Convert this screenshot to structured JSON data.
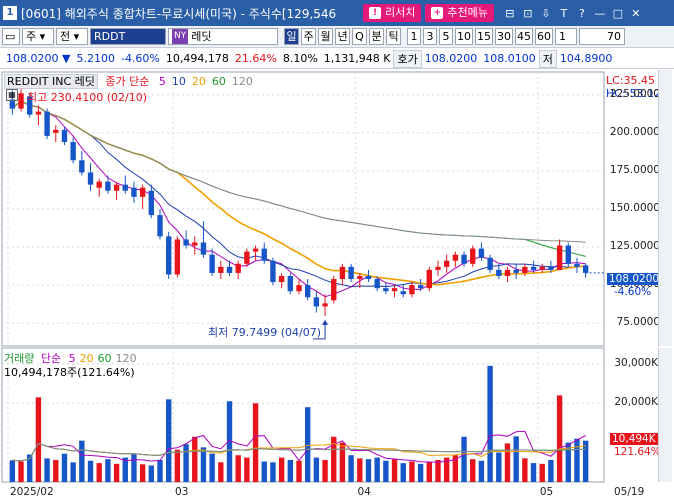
{
  "window": {
    "num": "1",
    "title": "[0601] 해외주식 종합차트-무료시세(미국) - 주식수[129,546",
    "btn_research": "리서치",
    "btn_recommend": "추천메뉴",
    "ctl_icons": [
      "⊟",
      "⊡",
      "⇩",
      "T",
      "?",
      "—",
      "□",
      "✕"
    ]
  },
  "toolbar": {
    "market": "주",
    "market2": "전",
    "symbol": "RDDT",
    "nv_badge": "NY",
    "name": "레딧",
    "periods": [
      "일",
      "주",
      "월",
      "년",
      "Q",
      "분",
      "틱"
    ],
    "active_period": "일",
    "intervals": [
      "1",
      "3",
      "5",
      "10",
      "15",
      "30",
      "45",
      "60"
    ],
    "interval_value": "1",
    "count": "70"
  },
  "info": {
    "price": "108.0200",
    "change": "5.2100",
    "change_rate": "-4.60%",
    "volume": "10,494,178",
    "vol_rate": "21.64%",
    "turnover": "8.10%",
    "amount": "1,131,948",
    "amount_unit": "K",
    "ask_label": "호가",
    "ask": "108.0200",
    "bid": "108.0100",
    "low_label": "저",
    "low": "104.8900"
  },
  "price_panel": {
    "name": "REDDIT INC",
    "name_ko": "레딧",
    "series_label": "종가 단순",
    "ma_periods": [
      "5",
      "10",
      "20",
      "60",
      "120"
    ],
    "ma_colors": [
      "#b000c0",
      "#1d3fb0",
      "#f0a000",
      "#1f9a2f",
      "#8a8a8a"
    ],
    "high_note": "최고 230.4100 (02/10)",
    "low_note": "최저 79.7499 (04/07)",
    "lc": "LC:35.45",
    "hc": "HC:-53.12",
    "cur_tag": "108.0200",
    "cur_rate": "-4.60%",
    "y_ticks": [
      "225.0000",
      "200.0000",
      "175.0000",
      "150.0000",
      "125.0000",
      "100.0000",
      "75.0000"
    ]
  },
  "volume_panel": {
    "label": "거래량",
    "series_label": "단순",
    "ma_periods": [
      "5",
      "20",
      "60",
      "120"
    ],
    "value_note": "10,494,178주(121.64%)",
    "y_ticks": [
      "30,000K",
      "20,000K"
    ],
    "cur_tag": "10,494K",
    "cur_rate": "121.64%"
  },
  "x_labels": [
    "2025/02",
    "03",
    "04",
    "05",
    "05/19"
  ],
  "colors": {
    "up": "#e8141b",
    "down": "#1656c9",
    "title_bg": "#2a5fa8",
    "accent": "#e5197a"
  },
  "chart_data": {
    "type": "candlestick",
    "ylim": [
      60,
      240
    ],
    "candles": [
      {
        "o": 222,
        "h": 228,
        "l": 212,
        "c": 216
      },
      {
        "o": 216,
        "h": 230.41,
        "l": 214,
        "c": 226
      },
      {
        "o": 224,
        "h": 226,
        "l": 210,
        "c": 212
      },
      {
        "o": 212,
        "h": 218,
        "l": 205,
        "c": 214
      },
      {
        "o": 214,
        "h": 216,
        "l": 196,
        "c": 198
      },
      {
        "o": 200,
        "h": 205,
        "l": 194,
        "c": 202
      },
      {
        "o": 202,
        "h": 204,
        "l": 192,
        "c": 194
      },
      {
        "o": 194,
        "h": 197,
        "l": 180,
        "c": 182
      },
      {
        "o": 182,
        "h": 188,
        "l": 172,
        "c": 174
      },
      {
        "o": 174,
        "h": 180,
        "l": 162,
        "c": 166
      },
      {
        "o": 164,
        "h": 170,
        "l": 158,
        "c": 168
      },
      {
        "o": 168,
        "h": 172,
        "l": 160,
        "c": 162
      },
      {
        "o": 162,
        "h": 168,
        "l": 156,
        "c": 166
      },
      {
        "o": 166,
        "h": 172,
        "l": 160,
        "c": 162
      },
      {
        "o": 164,
        "h": 168,
        "l": 154,
        "c": 158
      },
      {
        "o": 158,
        "h": 166,
        "l": 150,
        "c": 164
      },
      {
        "o": 162,
        "h": 166,
        "l": 144,
        "c": 146
      },
      {
        "o": 146,
        "h": 150,
        "l": 130,
        "c": 132
      },
      {
        "o": 132,
        "h": 135,
        "l": 104,
        "c": 107
      },
      {
        "o": 107,
        "h": 132,
        "l": 105,
        "c": 130
      },
      {
        "o": 130,
        "h": 136,
        "l": 124,
        "c": 126
      },
      {
        "o": 126,
        "h": 132,
        "l": 120,
        "c": 128
      },
      {
        "o": 128,
        "h": 142,
        "l": 118,
        "c": 120
      },
      {
        "o": 120,
        "h": 124,
        "l": 106,
        "c": 108
      },
      {
        "o": 108,
        "h": 116,
        "l": 104,
        "c": 112
      },
      {
        "o": 112,
        "h": 116,
        "l": 106,
        "c": 108
      },
      {
        "o": 108,
        "h": 116,
        "l": 104,
        "c": 114
      },
      {
        "o": 114,
        "h": 124,
        "l": 112,
        "c": 122
      },
      {
        "o": 122,
        "h": 126,
        "l": 116,
        "c": 124
      },
      {
        "o": 124,
        "h": 128,
        "l": 114,
        "c": 116
      },
      {
        "o": 116,
        "h": 118,
        "l": 100,
        "c": 102
      },
      {
        "o": 102,
        "h": 108,
        "l": 98,
        "c": 106
      },
      {
        "o": 106,
        "h": 108,
        "l": 94,
        "c": 96
      },
      {
        "o": 96,
        "h": 104,
        "l": 94,
        "c": 100
      },
      {
        "o": 100,
        "h": 104,
        "l": 90,
        "c": 92
      },
      {
        "o": 92,
        "h": 96,
        "l": 82,
        "c": 86
      },
      {
        "o": 86,
        "h": 94,
        "l": 79.75,
        "c": 88
      },
      {
        "o": 90,
        "h": 106,
        "l": 88,
        "c": 104
      },
      {
        "o": 104,
        "h": 114,
        "l": 100,
        "c": 112
      },
      {
        "o": 112,
        "h": 114,
        "l": 102,
        "c": 104
      },
      {
        "o": 104,
        "h": 108,
        "l": 98,
        "c": 106
      },
      {
        "o": 106,
        "h": 110,
        "l": 102,
        "c": 104
      },
      {
        "o": 104,
        "h": 106,
        "l": 96,
        "c": 98
      },
      {
        "o": 98,
        "h": 102,
        "l": 94,
        "c": 96
      },
      {
        "o": 96,
        "h": 100,
        "l": 92,
        "c": 98
      },
      {
        "o": 96,
        "h": 100,
        "l": 92,
        "c": 94
      },
      {
        "o": 94,
        "h": 102,
        "l": 92,
        "c": 100
      },
      {
        "o": 100,
        "h": 104,
        "l": 96,
        "c": 98
      },
      {
        "o": 98,
        "h": 112,
        "l": 96,
        "c": 110
      },
      {
        "o": 110,
        "h": 116,
        "l": 106,
        "c": 112
      },
      {
        "o": 112,
        "h": 120,
        "l": 108,
        "c": 116
      },
      {
        "o": 116,
        "h": 122,
        "l": 112,
        "c": 120
      },
      {
        "o": 120,
        "h": 122,
        "l": 112,
        "c": 114
      },
      {
        "o": 114,
        "h": 126,
        "l": 112,
        "c": 124
      },
      {
        "o": 124,
        "h": 128,
        "l": 116,
        "c": 118
      },
      {
        "o": 118,
        "h": 120,
        "l": 108,
        "c": 110
      },
      {
        "o": 110,
        "h": 114,
        "l": 104,
        "c": 106
      },
      {
        "o": 106,
        "h": 112,
        "l": 102,
        "c": 110
      },
      {
        "o": 110,
        "h": 114,
        "l": 104,
        "c": 108
      },
      {
        "o": 108,
        "h": 114,
        "l": 106,
        "c": 112
      },
      {
        "o": 112,
        "h": 116,
        "l": 108,
        "c": 110
      },
      {
        "o": 110,
        "h": 114,
        "l": 108,
        "c": 112
      },
      {
        "o": 112,
        "h": 116,
        "l": 108,
        "c": 110
      },
      {
        "o": 110,
        "h": 130,
        "l": 110,
        "c": 126
      },
      {
        "o": 126,
        "h": 128,
        "l": 112,
        "c": 114
      },
      {
        "o": 114,
        "h": 118,
        "l": 108,
        "c": 112
      },
      {
        "o": 113,
        "h": 114,
        "l": 104.89,
        "c": 108.02
      }
    ],
    "volumes": [
      5.5,
      5.2,
      7.0,
      21.5,
      6.0,
      5.6,
      7.2,
      5.0,
      10.5,
      5.4,
      4.8,
      5.8,
      4.6,
      6.2,
      7.0,
      4.5,
      4.2,
      5.6,
      21.0,
      8.2,
      9.6,
      11.5,
      8.8,
      7.2,
      5.0,
      20.5,
      6.8,
      6.2,
      20.0,
      5.2,
      5.0,
      6.2,
      5.6,
      5.4,
      19.0,
      6.2,
      5.6,
      11.5,
      10.0,
      6.8,
      6.0,
      5.8,
      6.2,
      5.4,
      5.8,
      4.8,
      5.2,
      4.6,
      5.0,
      5.6,
      6.2,
      6.8,
      11.5,
      5.8,
      5.4,
      29.5,
      7.5,
      9.8,
      11.6,
      6.0,
      4.8,
      4.6,
      5.6,
      22.0,
      10.0,
      11.0,
      10.49
    ],
    "vol_ylim": [
      0,
      32
    ]
  }
}
